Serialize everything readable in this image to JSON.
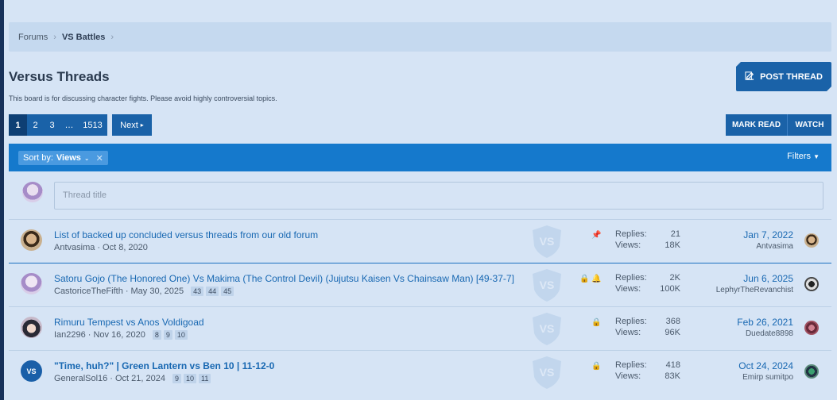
{
  "breadcrumb": {
    "items": [
      "Forums",
      "VS Battles"
    ],
    "separator": "›"
  },
  "page": {
    "title": "Versus Threads",
    "description": "This board is for discussing character fights. Please avoid highly controversial topics."
  },
  "actions": {
    "post_thread": "POST THREAD",
    "mark_read": "MARK READ",
    "watch": "WATCH"
  },
  "pagination": {
    "pages": [
      "1",
      "2",
      "3",
      "…",
      "1513"
    ],
    "current": "1",
    "next": "Next"
  },
  "filter_bar": {
    "sort_label": "Sort by:",
    "sort_value": "Views",
    "filters": "Filters"
  },
  "quick_thread": {
    "placeholder": "Thread title"
  },
  "threads": [
    {
      "title": "List of backed up concluded versus threads from our old forum",
      "author": "Antvasima",
      "date": "Oct 8, 2020",
      "pages": [],
      "replies_label": "Replies:",
      "replies": "21",
      "views_label": "Views:",
      "views": "18K",
      "last_date": "Jan 7, 2022",
      "last_user": "Antvasima",
      "icons": [
        "pin-icon"
      ]
    },
    {
      "title": "Satoru Gojo (The Honored One) Vs Makima (The Control Devil) (Jujutsu Kaisen Vs Chainsaw Man) [49-37-7]",
      "author": "CastoriceTheFifth",
      "date": "May 30, 2025",
      "pages": [
        "43",
        "44",
        "45"
      ],
      "replies_label": "Replies:",
      "replies": "2K",
      "views_label": "Views:",
      "views": "100K",
      "last_date": "Jun 6, 2025",
      "last_user": "LephyrTheRevanchist",
      "icons": [
        "lock-icon",
        "bell-icon"
      ]
    },
    {
      "title": "Rimuru Tempest vs Anos Voldigoad",
      "author": "Ian2296",
      "date": "Nov 16, 2020",
      "pages": [
        "8",
        "9",
        "10"
      ],
      "replies_label": "Replies:",
      "replies": "368",
      "views_label": "Views:",
      "views": "96K",
      "last_date": "Feb 26, 2021",
      "last_user": "Duedate8898",
      "icons": [
        "lock-icon"
      ]
    },
    {
      "title": "\"Time, huh?\" | Green Lantern vs Ben 10 | 11-12-0",
      "author": "GeneralSol16",
      "date": "Oct 21, 2024",
      "pages": [
        "9",
        "10",
        "11"
      ],
      "replies_label": "Replies:",
      "replies": "418",
      "views_label": "Views:",
      "views": "83K",
      "last_date": "Oct 24, 2024",
      "last_user": "Emirp sumitpo",
      "icons": [
        "lock-icon"
      ]
    }
  ],
  "colors": {
    "accent": "#1a62a8",
    "filter_bar": "#1579cc",
    "link": "#1868b2",
    "background": "#d6e4f5"
  }
}
